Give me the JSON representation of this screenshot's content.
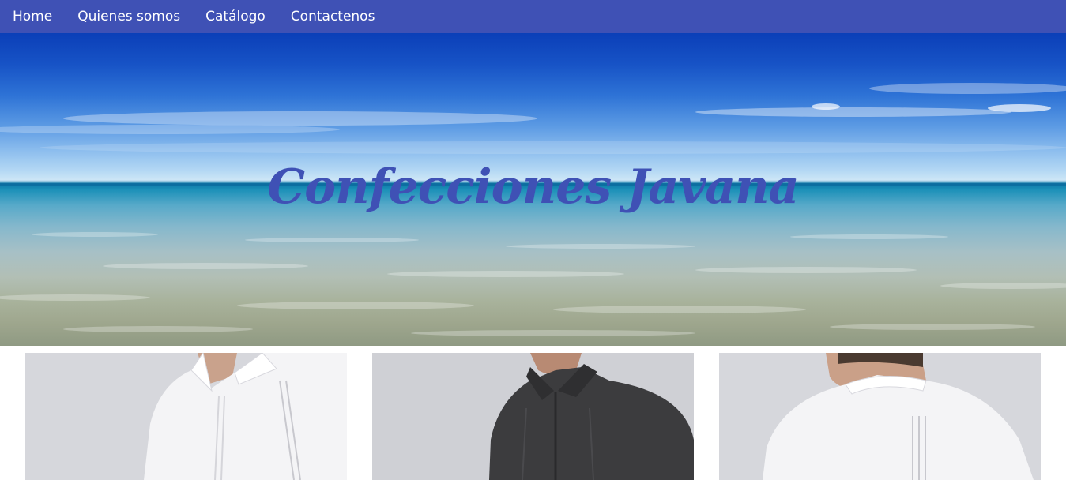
{
  "nav": {
    "items": [
      {
        "label": "Home"
      },
      {
        "label": "Quienes somos"
      },
      {
        "label": "Catálogo"
      },
      {
        "label": "Contactenos"
      }
    ]
  },
  "hero": {
    "title": "Confecciones Javana"
  },
  "products": [
    {
      "image": "white-guayabera-front"
    },
    {
      "image": "black-guayabera-front"
    },
    {
      "image": "white-guayabera-back"
    }
  ],
  "colors": {
    "nav_background": "#3f51b5",
    "title": "#3f51b5"
  }
}
